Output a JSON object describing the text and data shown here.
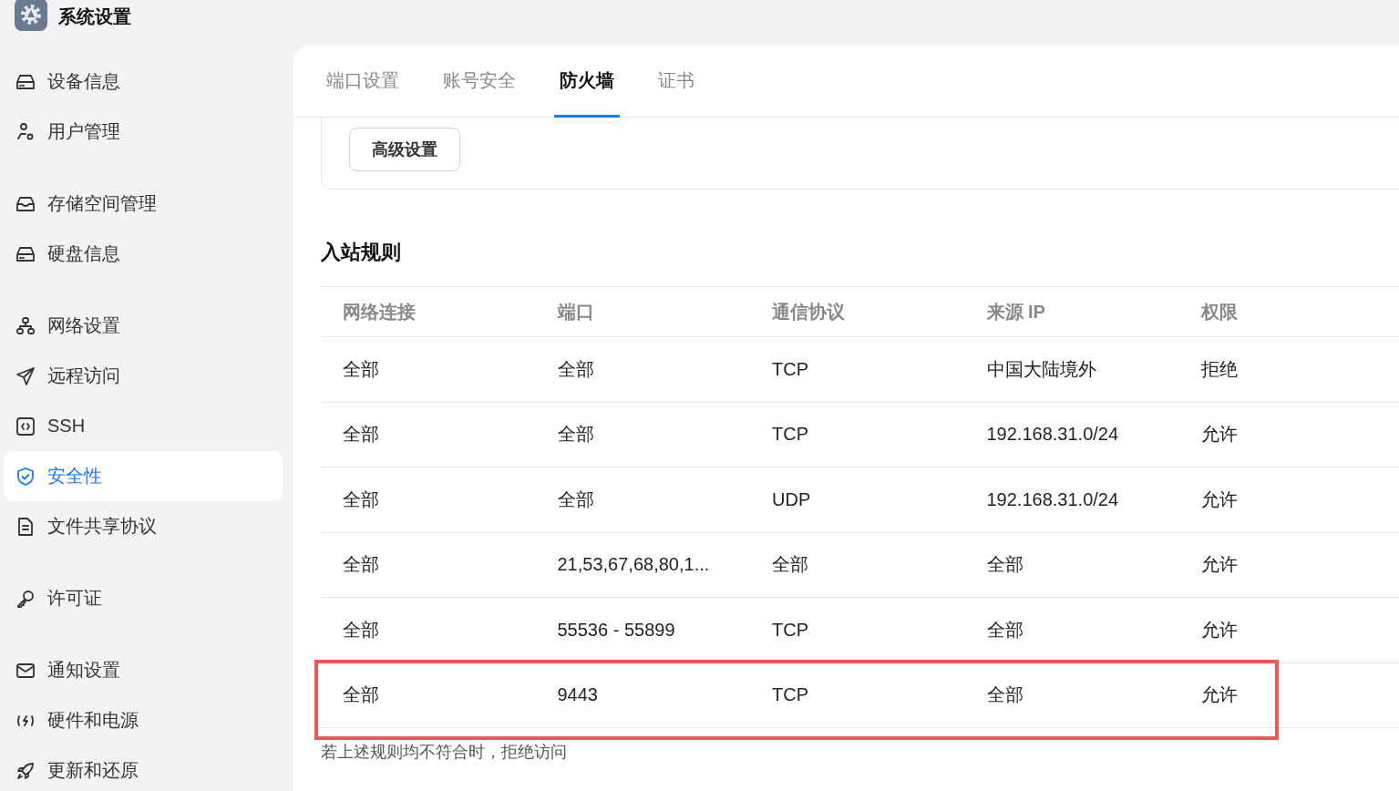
{
  "app": {
    "title": "系统设置"
  },
  "sidebar": {
    "groups": [
      {
        "items": [
          {
            "label": "设备信息",
            "selected": false
          },
          {
            "label": "用户管理",
            "selected": false
          }
        ]
      },
      {
        "items": [
          {
            "label": "存储空间管理",
            "selected": false
          },
          {
            "label": "硬盘信息",
            "selected": false
          }
        ]
      },
      {
        "items": [
          {
            "label": "网络设置",
            "selected": false
          },
          {
            "label": "远程访问",
            "selected": false
          },
          {
            "label": "SSH",
            "selected": false
          },
          {
            "label": "安全性",
            "selected": true
          },
          {
            "label": "文件共享协议",
            "selected": false
          }
        ]
      },
      {
        "items": [
          {
            "label": "许可证",
            "selected": false
          }
        ]
      },
      {
        "items": [
          {
            "label": "通知设置",
            "selected": false
          },
          {
            "label": "硬件和电源",
            "selected": false
          },
          {
            "label": "更新和还原",
            "selected": false
          }
        ]
      }
    ]
  },
  "tabs": [
    {
      "label": "端口设置",
      "selected": false
    },
    {
      "label": "账号安全",
      "selected": false
    },
    {
      "label": "防火墙",
      "selected": true
    },
    {
      "label": "证书",
      "selected": false
    }
  ],
  "advanced_button": "高级设置",
  "inbound_rules": {
    "title": "入站规则",
    "columns": [
      "网络连接",
      "端口",
      "通信协议",
      "来源 IP",
      "权限"
    ],
    "rows": [
      {
        "cells": [
          "全部",
          "全部",
          "TCP",
          "中国大陆境外",
          "拒绝"
        ],
        "highlighted": false
      },
      {
        "cells": [
          "全部",
          "全部",
          "TCP",
          "192.168.31.0/24",
          "允许"
        ],
        "highlighted": false
      },
      {
        "cells": [
          "全部",
          "全部",
          "UDP",
          "192.168.31.0/24",
          "允许"
        ],
        "highlighted": false
      },
      {
        "cells": [
          "全部",
          "21,53,67,68,80,1...",
          "全部",
          "全部",
          "允许"
        ],
        "highlighted": false
      },
      {
        "cells": [
          "全部",
          "55536 - 55899",
          "TCP",
          "全部",
          "允许"
        ],
        "highlighted": false
      },
      {
        "cells": [
          "全部",
          "9443",
          "TCP",
          "全部",
          "允许"
        ],
        "highlighted": true
      }
    ],
    "footnote": "若上述规则均不符合时，拒绝访问"
  }
}
